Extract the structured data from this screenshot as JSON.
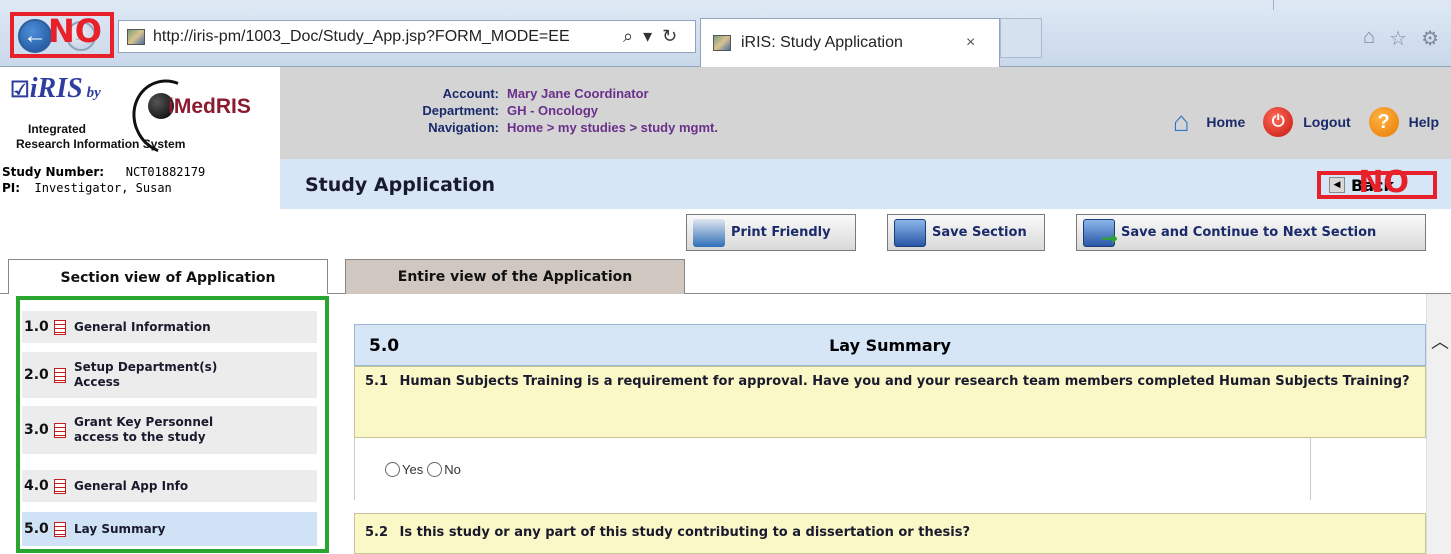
{
  "browser": {
    "back_overlay": "NO",
    "url": "http://iris-pm/1003_Doc/Study_App.jsp?FORM_MODE=EE",
    "search_glyph": "⌕",
    "dropdown_glyph": "▾",
    "refresh_glyph": "↻",
    "tab_title": "iRIS: Study Application",
    "tab_close": "×",
    "right_icons": [
      "home-icon",
      "star-icon",
      "gear-icon"
    ]
  },
  "header": {
    "logo_check": "☑",
    "logo_iris": "iRIS",
    "logo_by": "by",
    "logo_imedris": "iMedRIS",
    "logo_sub_line1": "Integrated",
    "logo_sub_line2": "Research Information System",
    "account_label": "Account:",
    "account_value": "Mary Jane Coordinator",
    "department_label": "Department:",
    "department_value": "GH - Oncology",
    "navigation_label": "Navigation:",
    "navigation_value": "Home > my studies > study mgmt.",
    "nav": {
      "home": "Home",
      "logout": "Logout",
      "help": "Help"
    }
  },
  "study": {
    "number_label": "Study Number:",
    "number_value": "NCT01882179",
    "pi_label": "PI:",
    "pi_value": "Investigator, Susan",
    "title": "Study Application",
    "back_label": "Back",
    "back_overlay": "NO"
  },
  "toolbar": {
    "print": "Print Friendly",
    "save": "Save Section",
    "save_next": "Save and Continue to Next Section"
  },
  "tabs": {
    "section_view": "Section view of Application",
    "entire_view": "Entire view of the Application"
  },
  "sidebar": {
    "items": [
      {
        "num": "1.0",
        "label": "General Information"
      },
      {
        "num": "2.0",
        "label": "Setup Department(s) Access"
      },
      {
        "num": "3.0",
        "label": "Grant Key Personnel access to the study"
      },
      {
        "num": "4.0",
        "label": "General App Info"
      },
      {
        "num": "5.0",
        "label": "Lay Summary"
      }
    ]
  },
  "content": {
    "section_num": "5.0",
    "section_title": "Lay Summary",
    "q1_num": "5.1",
    "q1_text": "Human Subjects Training is a requirement for approval. Have you and your research team members completed Human Subjects Training?",
    "q1_yes": "Yes",
    "q1_no": "No",
    "q2_num": "5.2",
    "q2_text": "Is this study or any part of this study contributing to a dissertation or thesis?"
  },
  "colors": {
    "annotation_red": "#e8202a",
    "annotation_green": "#2aa52f",
    "header_blue": "#d6e6f7",
    "question_yellow": "#fbf8c7"
  }
}
